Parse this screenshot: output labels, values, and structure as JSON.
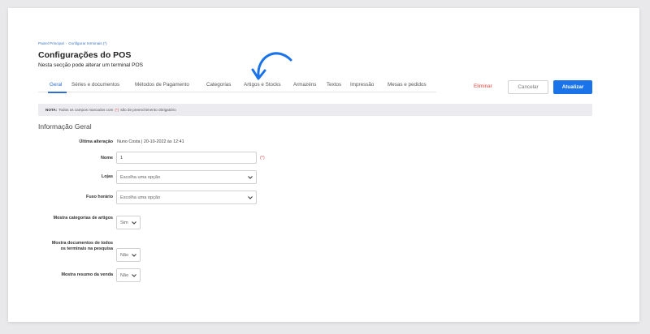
{
  "breadcrumb": {
    "home": "Painel Principal",
    "current": "Configurar terminais (*)"
  },
  "header": {
    "title": "Configurações do POS",
    "subtitle": "Nesta secção pode alterar um terminal POS"
  },
  "tabs": [
    {
      "label": "Geral",
      "active": true
    },
    {
      "label": "Séries e documentos",
      "active": false
    },
    {
      "label": "Métodos de Pagamento",
      "active": false
    },
    {
      "label": "Categorias",
      "active": false
    },
    {
      "label": "Artigos e Stocks",
      "active": false
    },
    {
      "label": "Armazéns",
      "active": false
    },
    {
      "label": "Textos",
      "active": false
    },
    {
      "label": "Impressão",
      "active": false
    },
    {
      "label": "Mesas e pedidos",
      "active": false
    }
  ],
  "actions": {
    "delete": "Eliminar",
    "cancel": "Cancelar",
    "update": "Atualizar"
  },
  "note": {
    "prefix": "NOTA:",
    "text_before": "Todos os campos marcados com",
    "required_marker": "(*)",
    "text_after": "são de preenchimento obrigatório"
  },
  "section": {
    "title": "Informação Geral"
  },
  "form": {
    "last_change_label": "Última alteração",
    "last_change_value": "Nuno Costa | 20-10-2022 às 12:41",
    "name_label": "Nome",
    "name_value": "1",
    "name_required": "(*)",
    "stores_label": "Lojas",
    "stores_value": "Escolha uma opção",
    "timezone_label": "Fuso horário",
    "timezone_value": "Escolha uma opção",
    "show_categories_label": "Mostra categorias de artigos",
    "show_categories_value": "Sim",
    "show_docs_label": "Mostra documentos de todos os terminais na pesquisa",
    "show_docs_value": "Não",
    "show_sales_summary_label": "Mostra resumo da venda",
    "show_sales_summary_value": "Não"
  },
  "colors": {
    "accent": "#1a73e8",
    "danger": "#e04a3f",
    "arrow": "#1a73e8"
  }
}
